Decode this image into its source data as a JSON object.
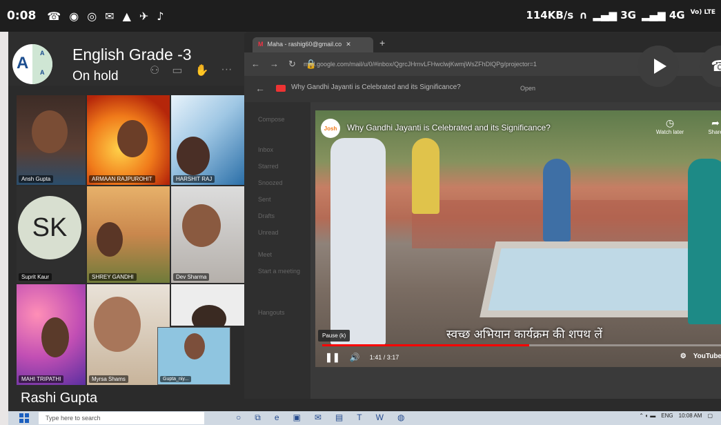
{
  "status_bar": {
    "time": "0:08",
    "network_speed": "114KB/s",
    "net_3g": "3G",
    "net_4g": "4G",
    "volte_label": "Vo) LTE"
  },
  "meeting": {
    "title": "English Grade -3",
    "status": "On hold",
    "logo_letter": "A",
    "logo_small": "A",
    "self_name": "Rashi  Gupta",
    "participants": [
      {
        "name": "Ansh Gupta"
      },
      {
        "name": "ARMAAN RAJPUROHIT"
      },
      {
        "name": "HARSHIT RAJ"
      },
      {
        "name": "Suprit Kaur",
        "initials": "SK"
      },
      {
        "name": "SHREY GANDHI"
      },
      {
        "name": "Dev Sharma"
      },
      {
        "name": "MAHI TRIPATHI"
      },
      {
        "name": "Myrsa Shams"
      },
      {
        "name": "Gupta_niy..."
      }
    ]
  },
  "browser": {
    "tab_title": "Maha - rashig60@gmail.co",
    "url": "mail.google.com/mail/u/0/#inbox/QgrcJHrnvLFHwclwjKwmjWsZFhDlQPg/projector=1",
    "page_title": "Why Gandhi Jayanti is Celebrated and its Significance?",
    "open_label": "Open",
    "gmail_items": [
      "Compose",
      "Inbox",
      "Starred",
      "Snoozed",
      "Sent",
      "Drafts",
      "Unread",
      "Meet",
      "Start a meeting",
      "Hangouts"
    ]
  },
  "video": {
    "channel_logo": "Josh",
    "title": "Why Gandhi Jayanti is Celebrated and its Significance?",
    "watch_later": "Watch later",
    "share": "Share",
    "caption": "स्वच्छ अभियान कार्यक्रम की शपथ लें",
    "pause_tooltip": "Pause (k)",
    "current_time": "1:41",
    "duration": "3:17",
    "progress_fraction": 0.512,
    "brand": "YouTube"
  },
  "taskbar": {
    "search_placeholder": "Type here to search",
    "lang": "ENG",
    "clock": "10:08 AM"
  }
}
